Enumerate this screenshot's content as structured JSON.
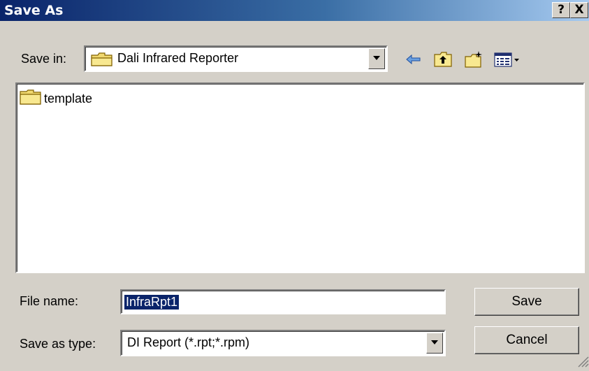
{
  "dialog": {
    "title": "Save As",
    "help_label": "?",
    "close_label": "X"
  },
  "save_in": {
    "label": "Save in:",
    "value": "Dali Infrared Reporter"
  },
  "toolbar": {
    "icons": [
      "back-arrow-icon",
      "up-one-level-icon",
      "new-folder-icon",
      "view-menu-icon"
    ]
  },
  "files": [
    {
      "name": "template",
      "icon": "folder-icon"
    }
  ],
  "file_name": {
    "label": "File name:",
    "value": "InfraRpt1"
  },
  "save_as_type": {
    "label": "Save as type:",
    "value": "DI Report (*.rpt;*.rpm)"
  },
  "buttons": {
    "save": "Save",
    "cancel": "Cancel"
  },
  "colors": {
    "titlebar_start": "#0a246a",
    "titlebar_end": "#a6caf0",
    "face": "#d4d0c8",
    "selection": "#0a246a"
  }
}
